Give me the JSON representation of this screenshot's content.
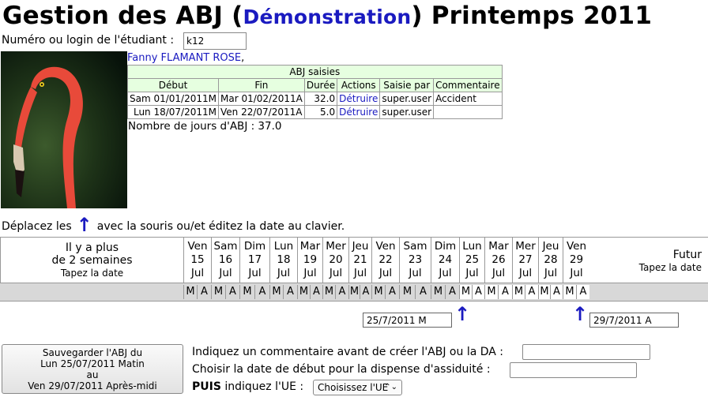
{
  "header": {
    "title_prefix": "Gestion des ABJ (",
    "title_link": "Démonstration",
    "title_suffix": ") Printemps 2011"
  },
  "login": {
    "label": "Numéro ou login de l'étudiant :",
    "value": "k12"
  },
  "student": {
    "name": "Fanny FLAMANT ROSE",
    "comma": ","
  },
  "abj_table": {
    "caption": "ABJ saisies",
    "columns": [
      "Début",
      "Fin",
      "Durée",
      "Actions",
      "Saisie par",
      "Commentaire"
    ],
    "rows": [
      [
        "Sam 01/01/2011M",
        "Mar 01/02/2011A",
        "32.0",
        "Détruire",
        "super.user",
        "Accident"
      ],
      [
        "Lun 18/07/2011M",
        "Ven 22/07/2011A",
        "5.0",
        "Détruire",
        "super.user",
        ""
      ]
    ]
  },
  "total_days": "Nombre de jours d'ABJ : 37.0",
  "move_hint": {
    "before": "Déplacez les",
    "arrow": "↑",
    "after": "avec la souris ou/et éditez la date au clavier."
  },
  "calendar": {
    "past_line1": "Il y a plus",
    "past_line2": "de 2 semaines",
    "past_hint": "Tapez la date",
    "future_label": "Futur",
    "future_hint": "Tapez la date",
    "days": [
      {
        "name": "Ven",
        "num": "15",
        "month": "Jul"
      },
      {
        "name": "Sam",
        "num": "16",
        "month": "Jul"
      },
      {
        "name": "Dim",
        "num": "17",
        "month": "Jul"
      },
      {
        "name": "Lun",
        "num": "18",
        "month": "Jul"
      },
      {
        "name": "Mar",
        "num": "19",
        "month": "Jul"
      },
      {
        "name": "Mer",
        "num": "20",
        "month": "Jul"
      },
      {
        "name": "Jeu",
        "num": "21",
        "month": "Jul"
      },
      {
        "name": "Ven",
        "num": "22",
        "month": "Jul"
      },
      {
        "name": "Sam",
        "num": "23",
        "month": "Jul"
      },
      {
        "name": "Dim",
        "num": "24",
        "month": "Jul"
      },
      {
        "name": "Lun",
        "num": "25",
        "month": "Jul"
      },
      {
        "name": "Mar",
        "num": "26",
        "month": "Jul"
      },
      {
        "name": "Mer",
        "num": "27",
        "month": "Jul"
      },
      {
        "name": "Jeu",
        "num": "28",
        "month": "Jul"
      },
      {
        "name": "Ven",
        "num": "29",
        "month": "Jul"
      }
    ],
    "slot_labels": [
      "M",
      "A"
    ],
    "selected_days": [
      10,
      11,
      12,
      13,
      14
    ],
    "start_date": "25/7/2011 M",
    "end_date": "29/7/2011 A"
  },
  "save_button": {
    "line1": "Sauvegarder l'ABJ du",
    "line2": "Lun 25/07/2011 Matin",
    "line3": "au",
    "line4": "Ven 29/07/2011 Après-midi"
  },
  "form": {
    "comment_label": "Indiquez un commentaire avant de créer l'ABJ ou la DA :",
    "dispense_label": "Choisir la date de début pour la dispense d'assiduité :",
    "ue_bold": "PUIS",
    "ue_label": " indiquez l'UE :",
    "ue_select": "Choisissez l'UE"
  },
  "colors": {
    "link": "#1a1ac0",
    "table_header_bg": "#e6ffe0",
    "slot_bg": "#d8d8d8"
  }
}
